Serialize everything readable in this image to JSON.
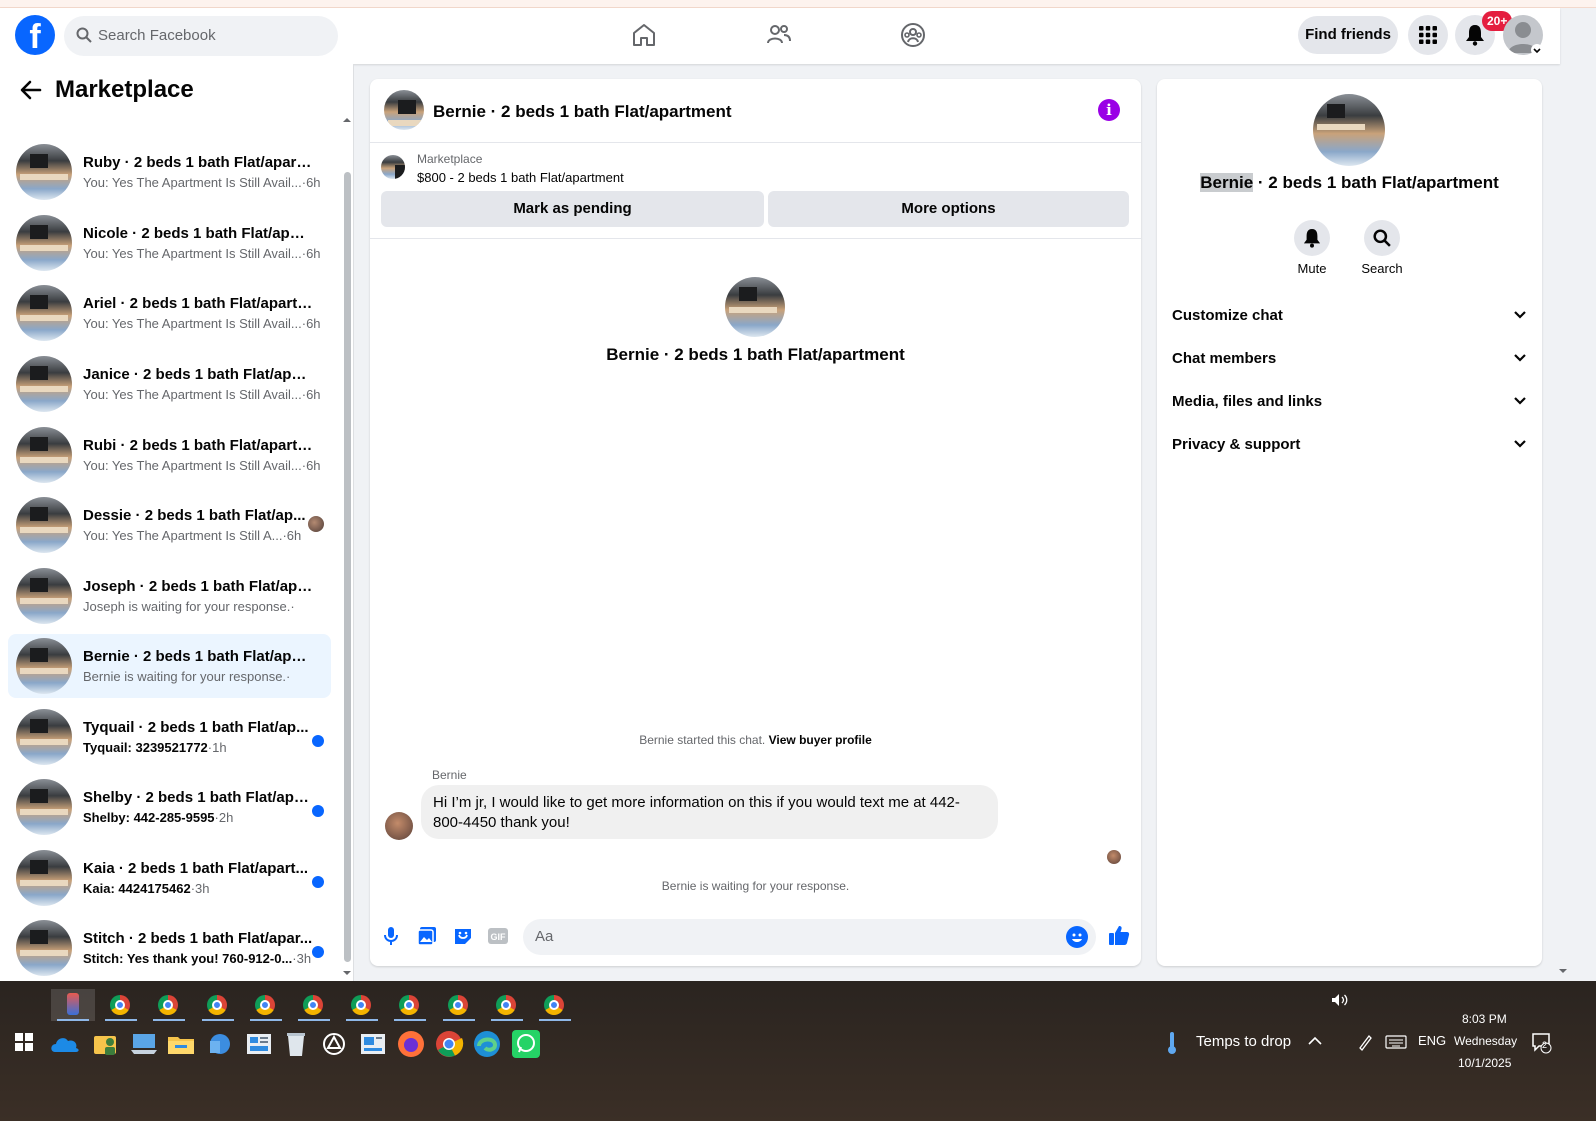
{
  "header": {
    "search_placeholder": "Search Facebook",
    "find_friends": "Find friends",
    "notif_badge": "20+"
  },
  "left": {
    "title": "Marketplace",
    "conversations": [
      {
        "name": "Ruby · 2 beds 1 bath Flat/apart...",
        "preview": "You: Yes The Apartment Is Still Avail...",
        "time": "·6h"
      },
      {
        "name": "Nicole · 2 beds 1 bath Flat/apart...",
        "preview": "You: Yes The Apartment Is Still Avail...",
        "time": "·6h"
      },
      {
        "name": "Ariel · 2 beds 1 bath Flat/apartm...",
        "preview": "You: Yes The Apartment Is Still Avail...",
        "time": "·6h"
      },
      {
        "name": "Janice · 2 beds 1 bath Flat/apart...",
        "preview": "You: Yes The Apartment Is Still Avail...",
        "time": "·6h"
      },
      {
        "name": "Rubi · 2 beds 1 bath Flat/apartm...",
        "preview": "You: Yes The Apartment Is Still Avail...",
        "time": "·6h"
      },
      {
        "name": "Dessie · 2 beds 1 bath Flat/ap...",
        "preview": "You: Yes The Apartment Is Still A...",
        "time": "·6h"
      },
      {
        "name": "Joseph · 2 beds 1 bath Flat/apart...",
        "preview": "Joseph is waiting for your response.",
        "time": "·"
      },
      {
        "name": "Bernie · 2 beds 1 bath Flat/apart...",
        "preview": "Bernie is waiting for your response.",
        "time": "·"
      },
      {
        "name": "Tyquail · 2 beds 1 bath Flat/ap...",
        "preview": "Tyquail: 3239521772",
        "time": "·1h"
      },
      {
        "name": "Shelby · 2 beds 1 bath Flat/apa...",
        "preview": "Shelby: 442-285-9595",
        "time": "·2h"
      },
      {
        "name": "Kaia · 2 beds 1 bath Flat/apart...",
        "preview": "Kaia: 4424175462",
        "time": "·3h"
      },
      {
        "name": "Stitch · 2 beds 1 bath Flat/apar...",
        "preview": "Stitch: Yes thank you! 760-912-0...",
        "time": "·3h"
      }
    ]
  },
  "chat": {
    "title": "Bernie · 2 beds 1 bath Flat/apartment",
    "listing_source": "Marketplace",
    "listing_price": "$800 - 2 beds 1 bath Flat/apartment",
    "mark_pending": "Mark as pending",
    "more_options": "More options",
    "hero_title": "Bernie · 2 beds 1 bath Flat/apartment",
    "started_text": "Bernie started this chat.",
    "view_profile": "View buyer profile",
    "sender": "Bernie",
    "message": "Hi I’m jr, I would like to get more information on this if you would text me at 442-800-4450 thank you!",
    "waiting": "Bernie is waiting for your response.",
    "input_placeholder": "Aa"
  },
  "details": {
    "name_highlight": "Bernie",
    "name_rest": " · 2 beds 1 bath Flat/apartment",
    "mute": "Mute",
    "search": "Search",
    "sections": [
      "Customize chat",
      "Chat members",
      "Media, files and links",
      "Privacy & support"
    ]
  },
  "taskbar": {
    "weather": "Temps to drop",
    "lang": "ENG",
    "time": "8:03 PM",
    "day": "Wednesday",
    "date": "10/1/2025",
    "notif_count": "2"
  },
  "colors": {
    "brand": "#0866ff",
    "active_row": "#ebf5ff",
    "info_icon": "#9a00e6",
    "badge": "#e41e3f"
  }
}
